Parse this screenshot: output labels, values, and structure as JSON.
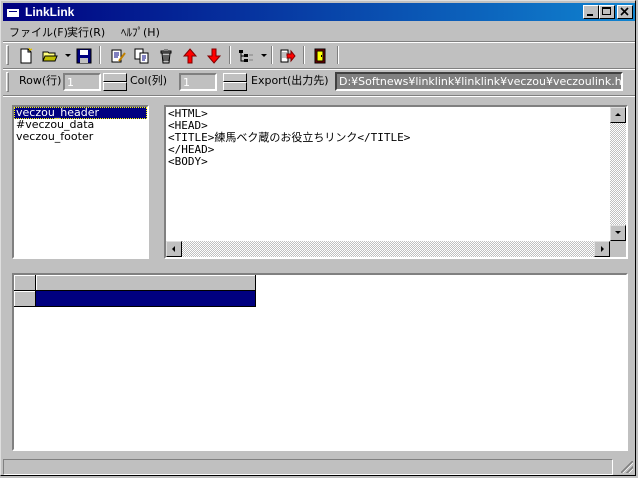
{
  "window": {
    "title": "LinkLink"
  },
  "menu": [
    {
      "label": "ファイル(F)"
    },
    {
      "label": "実行(R)"
    },
    {
      "label": "ﾍﾙﾌﾟ(H)"
    }
  ],
  "toolbar": {
    "buttons": [
      "new-file",
      "open-folder",
      "save",
      "edit-item",
      "copy-item",
      "delete",
      "move-up",
      "move-down",
      "tree-view",
      "export",
      "exit"
    ]
  },
  "params": {
    "row_label": "Row(行)",
    "row_value": "1",
    "col_label": "Col(列)",
    "col_value": "1",
    "export_label": "Export(出力先)",
    "export_path": "D:¥Softnews¥linklink¥linklink¥veczou¥veczoulink.html"
  },
  "list": {
    "items": [
      "veczou_header",
      "#veczou_data",
      "veczou_footer"
    ],
    "selected_index": 0
  },
  "editor": {
    "lines": [
      "<HTML>",
      "<HEAD>",
      "<TITLE>練馬ベク蔵のお役立ちリンク</TITLE>",
      "</HEAD>",
      "<BODY>"
    ]
  },
  "colors": {
    "title_start": "#000080",
    "title_end": "#1084d0",
    "selection": "#000080",
    "face": "#c0c0c0"
  }
}
